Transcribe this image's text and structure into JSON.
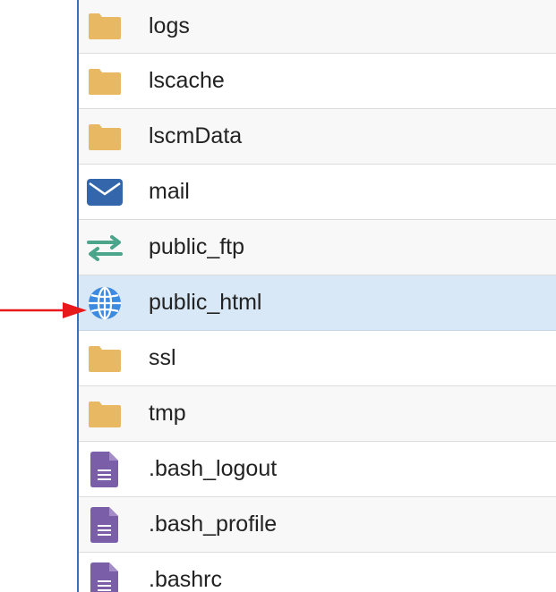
{
  "colors": {
    "folder": "#e8b862",
    "mail": "#3366aa",
    "transfer": "#4aa58a",
    "globe": "#3d8be0",
    "document": "#7b5ea8",
    "selected_row": "#d9e8f6",
    "arrow": "#e8191a"
  },
  "files": [
    {
      "name": "logs",
      "icon": "folder-icon"
    },
    {
      "name": "lscache",
      "icon": "folder-icon"
    },
    {
      "name": "lscmData",
      "icon": "folder-icon"
    },
    {
      "name": "mail",
      "icon": "mail-icon"
    },
    {
      "name": "public_ftp",
      "icon": "transfer-icon"
    },
    {
      "name": "public_html",
      "icon": "globe-icon",
      "selected": true
    },
    {
      "name": "ssl",
      "icon": "folder-icon"
    },
    {
      "name": "tmp",
      "icon": "folder-icon"
    },
    {
      "name": ".bash_logout",
      "icon": "document-icon"
    },
    {
      "name": ".bash_profile",
      "icon": "document-icon"
    },
    {
      "name": ".bashrc",
      "icon": "document-icon"
    }
  ],
  "annotation": {
    "icon": "red-arrow-icon",
    "points_to": "public_html"
  }
}
